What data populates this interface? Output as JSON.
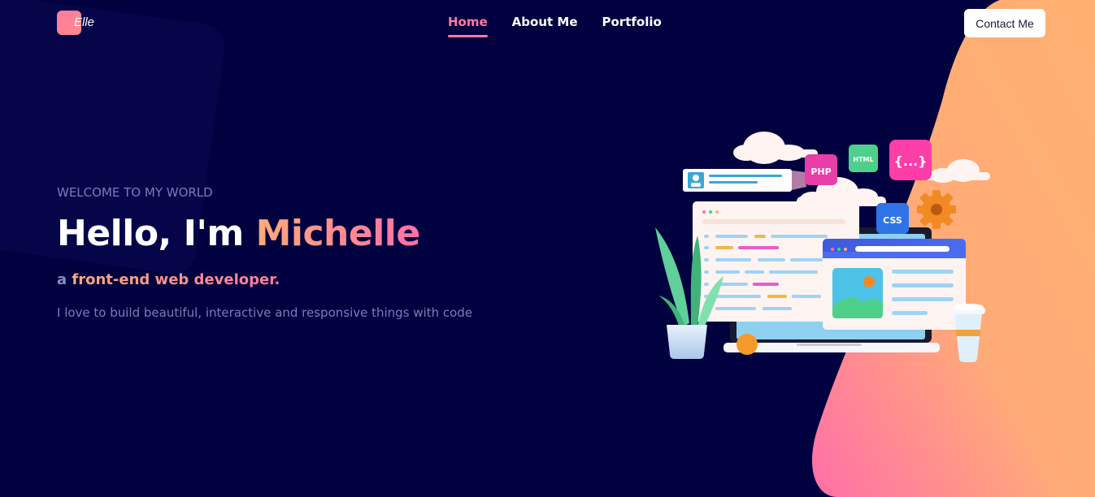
{
  "brand": {
    "name": "Elle"
  },
  "nav": {
    "items": [
      {
        "label": "Home",
        "active": true
      },
      {
        "label": "About Me",
        "active": false
      },
      {
        "label": "Portfolio",
        "active": false
      }
    ],
    "contact_label": "Contact Me"
  },
  "hero": {
    "welcome": "WELCOME TO MY WORLD",
    "greeting": "Hello, I'm ",
    "name": "Michelle",
    "role_prefix": "a ",
    "role": "front-end web developer.",
    "tagline": "I love to build beautiful, interactive and responsive things with code"
  },
  "illustration": {
    "badges": [
      "PHP",
      "HTML",
      "{...}",
      "CSS"
    ]
  },
  "colors": {
    "background": "#020140",
    "accent_pink": "#ff7aa0",
    "accent_orange": "#ffab78"
  }
}
